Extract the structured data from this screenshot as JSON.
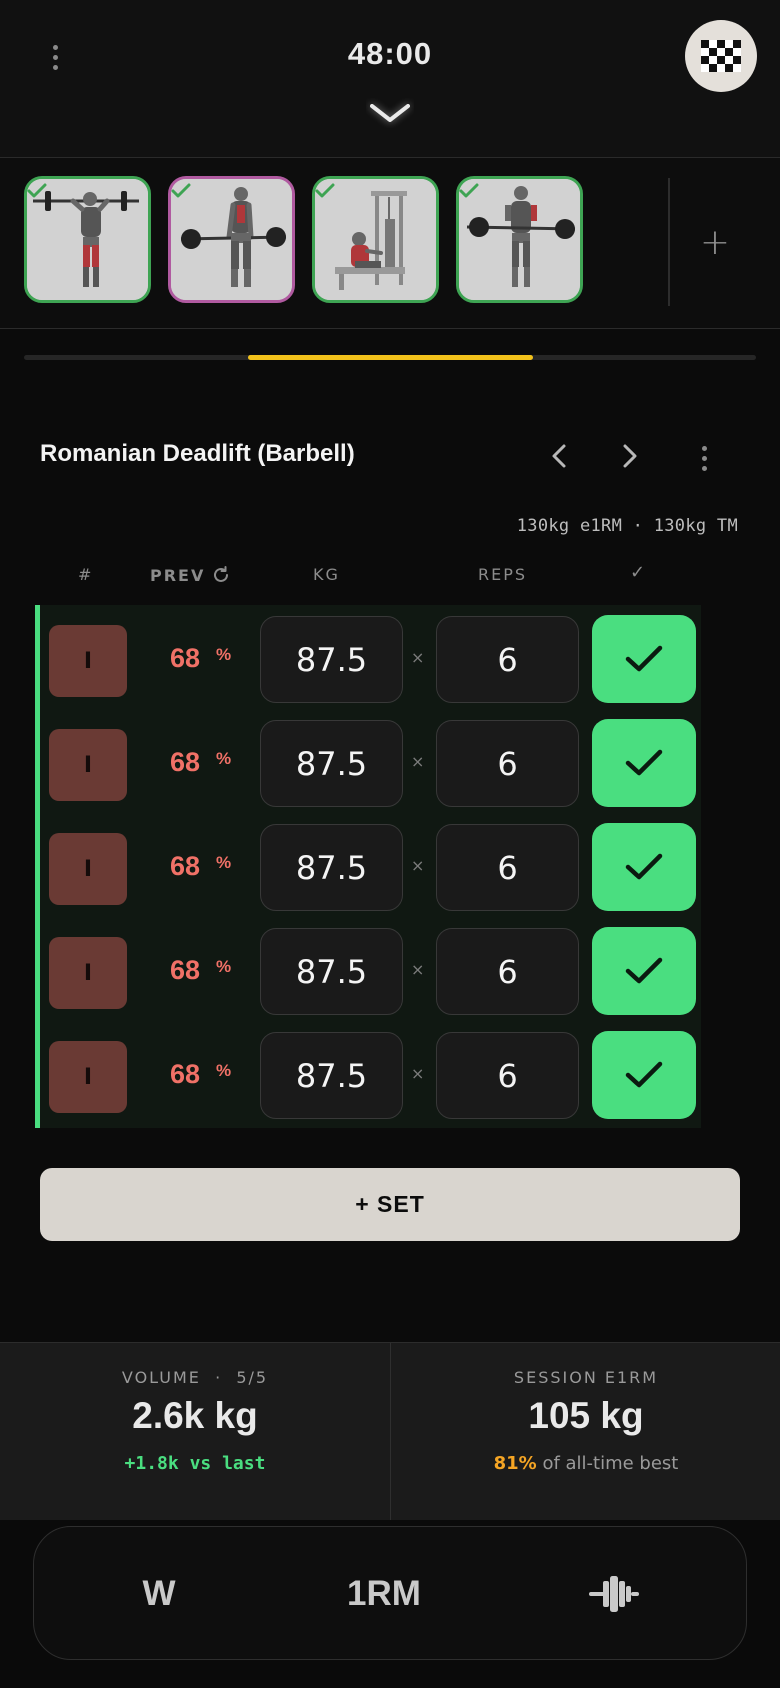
{
  "header": {
    "timer": "48:00"
  },
  "exercise_strip": {
    "items": [
      {
        "name": "overhead-press",
        "completed": true,
        "active": false
      },
      {
        "name": "romanian-deadlift",
        "completed": true,
        "active": true
      },
      {
        "name": "seated-cable-row",
        "completed": true,
        "active": false
      },
      {
        "name": "barbell-curl",
        "completed": true,
        "active": false
      }
    ],
    "add_label": "+"
  },
  "progress": {
    "fraction": 0.39
  },
  "exercise": {
    "title": "Romanian Deadlift (Barbell)",
    "stats": "130kg e1RM · 130kg TM"
  },
  "table": {
    "headers": {
      "num": "#",
      "prev": "PREV",
      "kg": "KG",
      "reps": "REPS",
      "done": "✓"
    },
    "times_sign": "×",
    "sets": [
      {
        "type": "I",
        "pct": "68",
        "pct_sign": "%",
        "kg": "87.5",
        "reps": "6",
        "done": true
      },
      {
        "type": "I",
        "pct": "68",
        "pct_sign": "%",
        "kg": "87.5",
        "reps": "6",
        "done": true
      },
      {
        "type": "I",
        "pct": "68",
        "pct_sign": "%",
        "kg": "87.5",
        "reps": "6",
        "done": true
      },
      {
        "type": "I",
        "pct": "68",
        "pct_sign": "%",
        "kg": "87.5",
        "reps": "6",
        "done": true
      },
      {
        "type": "I",
        "pct": "68",
        "pct_sign": "%",
        "kg": "87.5",
        "reps": "6",
        "done": true
      }
    ]
  },
  "add_set_label": "+ SET",
  "summary": {
    "volume_label": "VOLUME  ·  5/5",
    "volume_value": "2.6k kg",
    "volume_delta": "+1.8k vs last",
    "e1rm_label": "SESSION E1RM",
    "e1rm_value": "105 kg",
    "e1rm_pct": "81%",
    "e1rm_suffix": " of all-time best"
  },
  "tools": {
    "warmup": "W",
    "one_rm": "1RM",
    "plate_icon": "plate-calculator-icon"
  },
  "colors": {
    "accent_green": "#4ade80",
    "progress_yellow": "#f2c21b",
    "pct_red": "#f07167",
    "active_border": "#b05aa0",
    "highlight_orange": "#f5a524"
  }
}
